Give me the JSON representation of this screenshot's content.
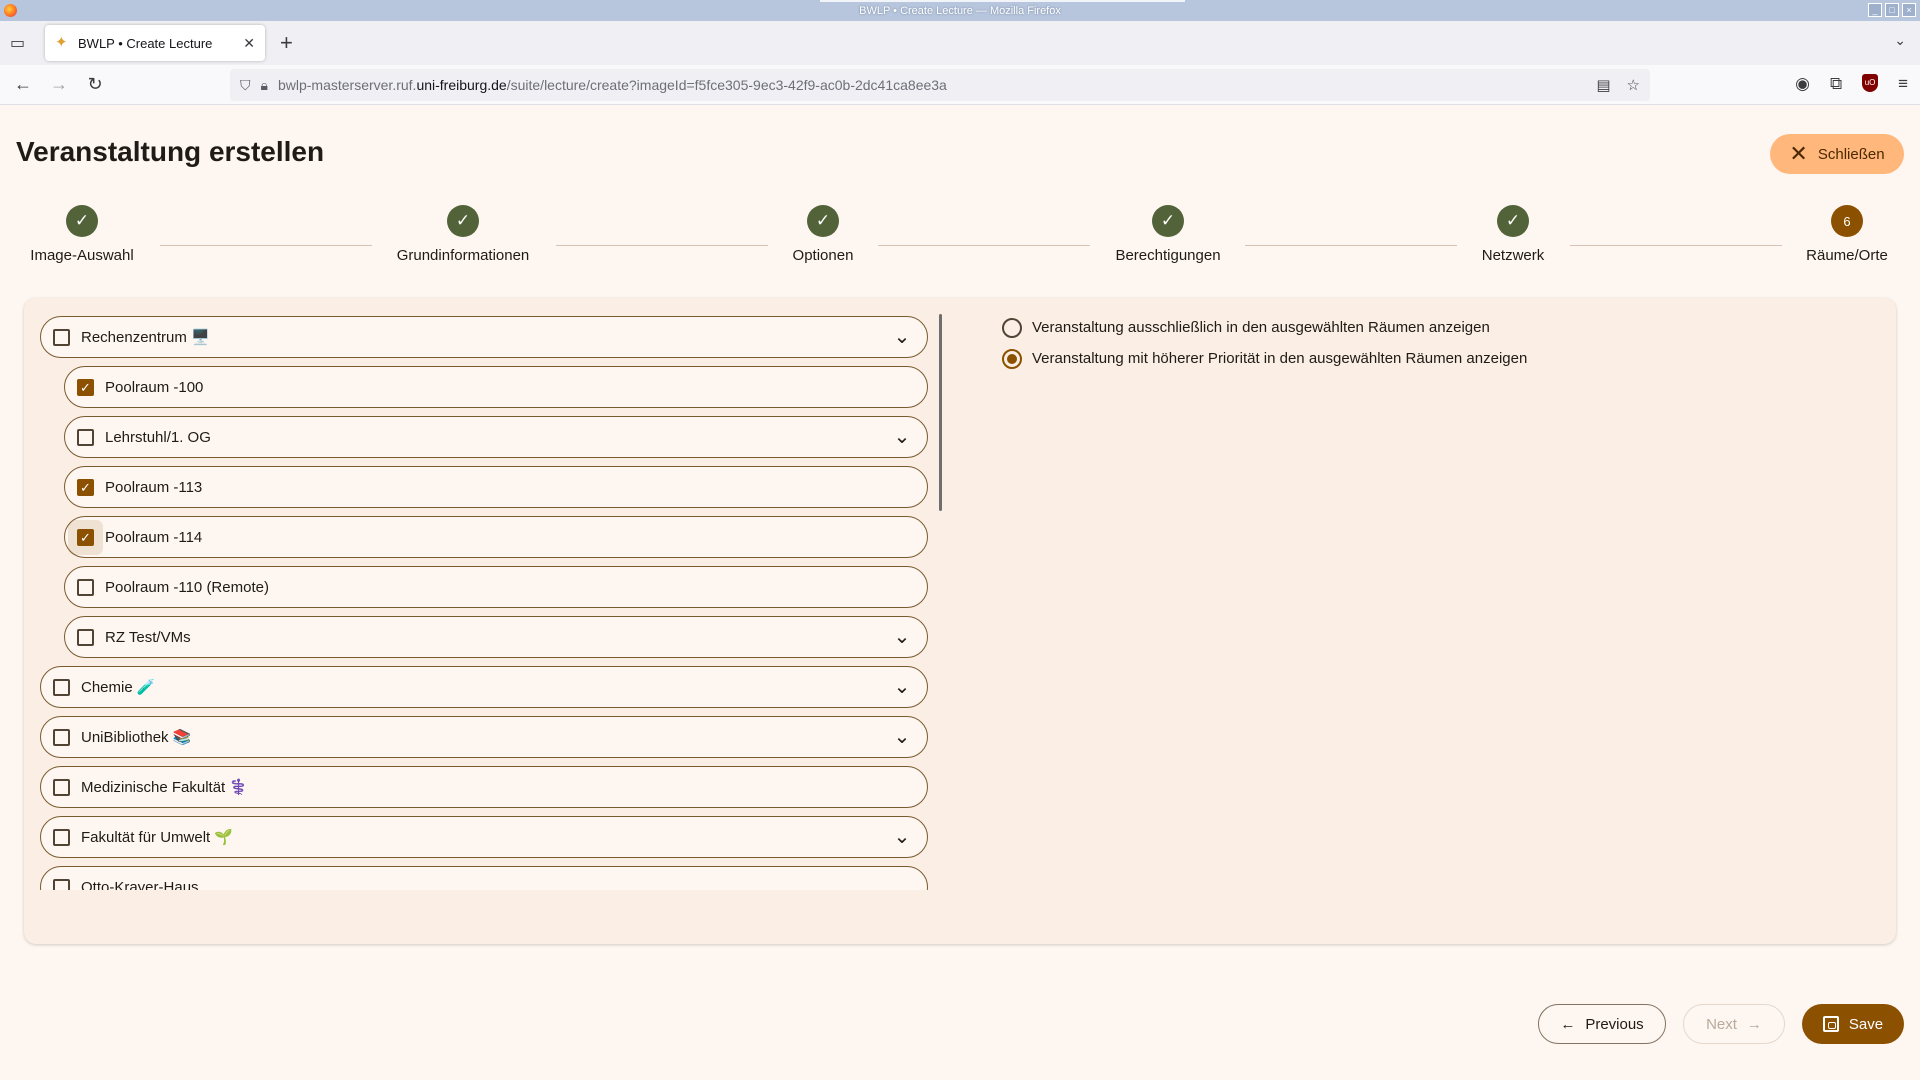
{
  "browser": {
    "window_title": "BWLP • Create Lecture — Mozilla Firefox",
    "tab_title": "BWLP • Create Lecture",
    "url_prefix": "bwlp-masterserver.ruf.",
    "url_domain": "uni-freiburg.de",
    "url_path": "/suite/lecture/create?imageId=f5fce305-9ec3-42f9-ac0b-2dc41ca8ee3a"
  },
  "page": {
    "title": "Veranstaltung erstellen",
    "close_label": "Schließen"
  },
  "stepper": {
    "steps": [
      {
        "label": "Image-Auswahl",
        "state": "done"
      },
      {
        "label": "Grundinformationen",
        "state": "done"
      },
      {
        "label": "Optionen",
        "state": "done"
      },
      {
        "label": "Berechtigungen",
        "state": "done"
      },
      {
        "label": "Netzwerk",
        "state": "done"
      },
      {
        "label": "Räume/Orte",
        "state": "current",
        "number": "6"
      }
    ]
  },
  "locations": {
    "items": [
      {
        "label": "Rechenzentrum 🖥️",
        "checked": false,
        "expandable": true,
        "level": 0
      },
      {
        "label": "Poolraum -100",
        "checked": true,
        "expandable": false,
        "level": 1
      },
      {
        "label": "Lehrstuhl/1. OG",
        "checked": false,
        "expandable": true,
        "level": 1
      },
      {
        "label": "Poolraum -113",
        "checked": true,
        "expandable": false,
        "level": 1
      },
      {
        "label": "Poolraum -114",
        "checked": true,
        "expandable": false,
        "level": 1
      },
      {
        "label": "Poolraum -110 (Remote)",
        "checked": false,
        "expandable": false,
        "level": 1
      },
      {
        "label": "RZ Test/VMs",
        "checked": false,
        "expandable": true,
        "level": 1
      },
      {
        "label": "Chemie 🧪",
        "checked": false,
        "expandable": true,
        "level": 0
      },
      {
        "label": "UniBibliothek 📚",
        "checked": false,
        "expandable": true,
        "level": 0
      },
      {
        "label": "Medizinische Fakultät ⚕️",
        "checked": false,
        "expandable": false,
        "level": 0
      },
      {
        "label": "Fakultät für Umwelt 🌱",
        "checked": false,
        "expandable": true,
        "level": 0
      },
      {
        "label": "Otto-Krayer-Haus",
        "checked": false,
        "expandable": false,
        "level": 0
      }
    ]
  },
  "visibility_options": {
    "options": [
      {
        "label": "Veranstaltung ausschließlich in den ausgewählten Räumen anzeigen",
        "selected": false
      },
      {
        "label": "Veranstaltung mit höherer Priorität in den ausgewählten Räumen anzeigen",
        "selected": true
      }
    ]
  },
  "footer": {
    "previous_label": "Previous",
    "next_label": "Next",
    "save_label": "Save"
  },
  "colors": {
    "primary": "#8b5000",
    "step_done": "#52633a",
    "close_button": "#ffb77c",
    "background": "#fdf6f1"
  }
}
